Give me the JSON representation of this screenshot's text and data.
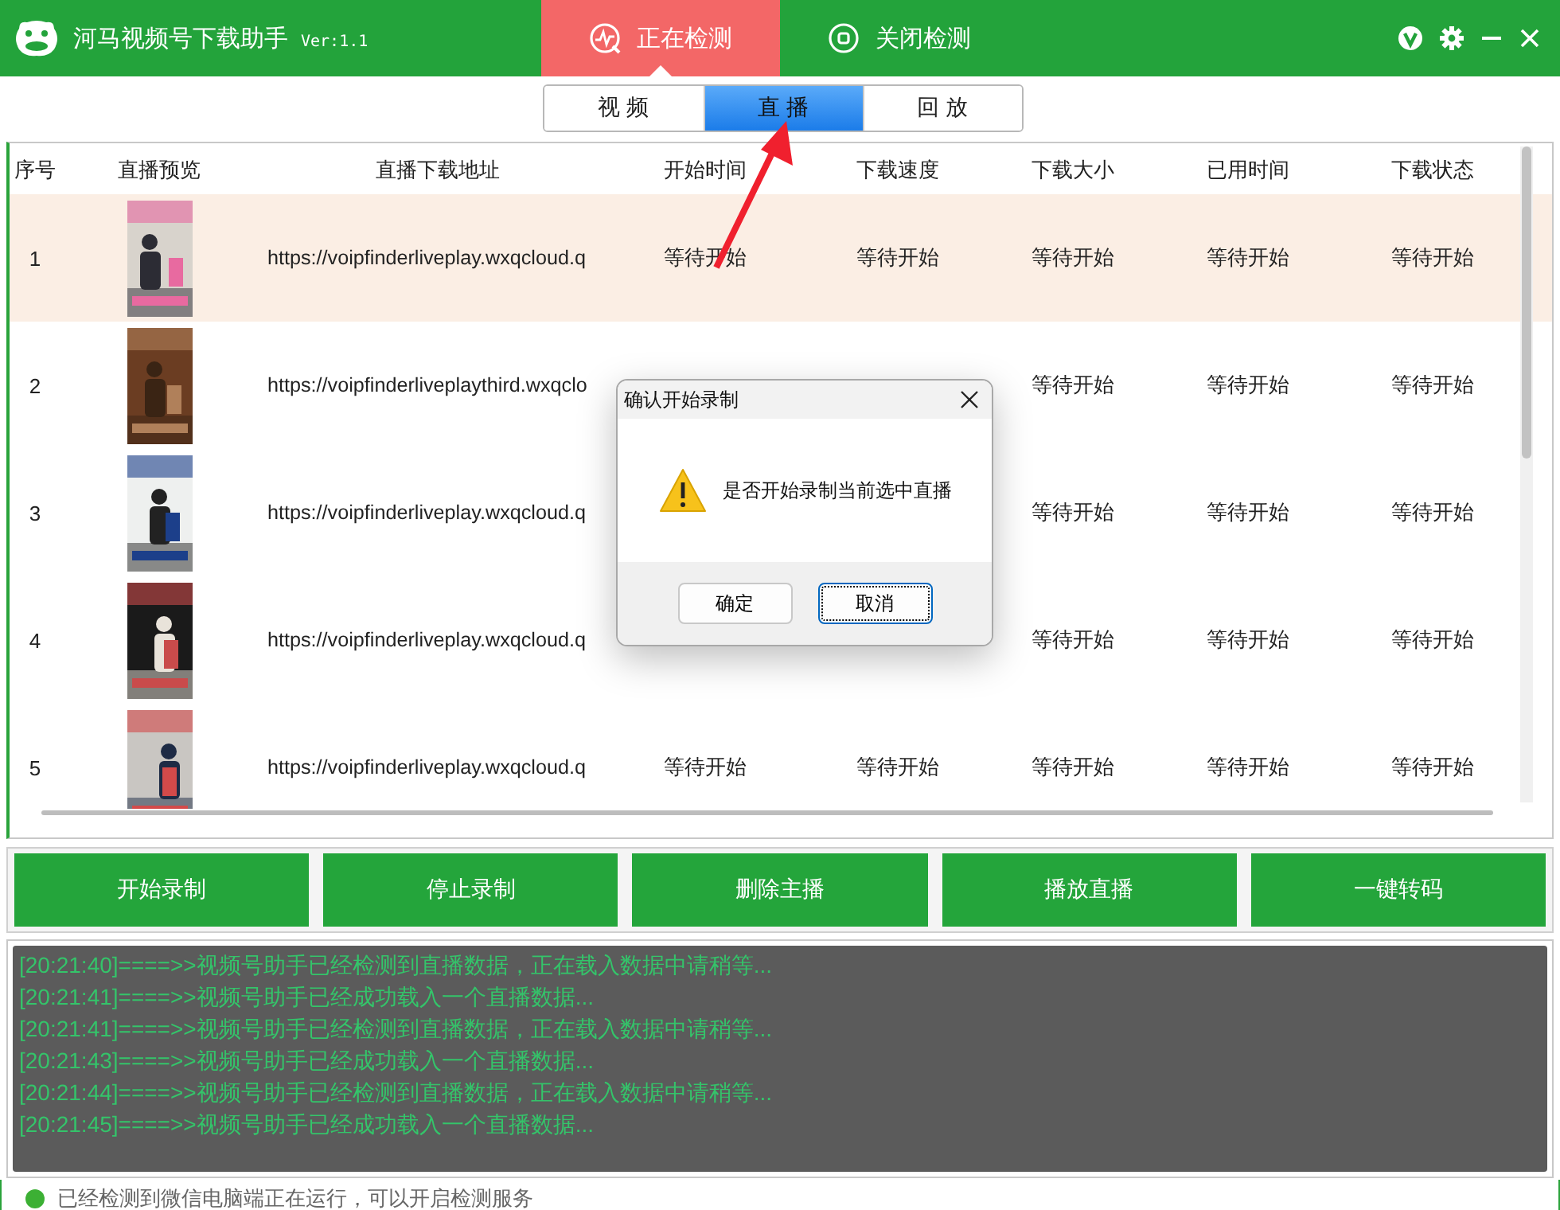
{
  "app": {
    "title": "河马视频号下载助手",
    "version": "Ver:1.1"
  },
  "top_tabs": [
    {
      "label": "正在检测",
      "selected": true,
      "kind": "radar"
    },
    {
      "label": "关闭检测",
      "selected": false,
      "kind": "stop"
    }
  ],
  "mode_tabs": [
    {
      "label": "视 频",
      "selected": false
    },
    {
      "label": "直 播",
      "selected": true
    },
    {
      "label": "回 放",
      "selected": false
    }
  ],
  "table": {
    "columns": [
      "序号",
      "直播预览",
      "直播下载地址",
      "开始时间",
      "下载速度",
      "下载大小",
      "已用时间",
      "下载状态"
    ],
    "rows": [
      {
        "index": "1",
        "url": "https://voipfinderliveplay.wxqcloud.q",
        "start_time": "等待开始",
        "speed": "等待开始",
        "size": "等待开始",
        "elapsed": "等待开始",
        "status": "等待开始",
        "selected": true
      },
      {
        "index": "2",
        "url": "https://voipfinderliveplaythird.wxqclo",
        "size": "等待开始",
        "elapsed": "等待开始",
        "status": "等待开始",
        "selected": false
      },
      {
        "index": "3",
        "url": "https://voipfinderliveplay.wxqcloud.q",
        "size": "等待开始",
        "elapsed": "等待开始",
        "status": "等待开始",
        "selected": false
      },
      {
        "index": "4",
        "url": "https://voipfinderliveplay.wxqcloud.q",
        "size": "等待开始",
        "elapsed": "等待开始",
        "status": "等待开始",
        "selected": false
      },
      {
        "index": "5",
        "url": "https://voipfinderliveplay.wxqcloud.q",
        "start_time": "等待开始",
        "speed": "等待开始",
        "size": "等待开始",
        "elapsed": "等待开始",
        "status": "等待开始",
        "selected": false
      }
    ]
  },
  "buttons": [
    "开始录制",
    "停止录制",
    "删除主播",
    "播放直播",
    "一键转码"
  ],
  "log": [
    "[20:21:40]====>>视频号助手已经检测到直播数据，正在载入数据中请稍等...",
    "[20:21:41]====>>视频号助手已经成功载入一个直播数据...",
    "[20:21:41]====>>视频号助手已经检测到直播数据，正在载入数据中请稍等...",
    "[20:21:43]====>>视频号助手已经成功载入一个直播数据...",
    "[20:21:44]====>>视频号助手已经检测到直播数据，正在载入数据中请稍等...",
    "[20:21:45]====>>视频号助手已经成功载入一个直播数据..."
  ],
  "status_bar": {
    "text": "已经检测到微信电脑端正在运行，可以开启检测服务"
  },
  "dialog": {
    "title": "确认开始录制",
    "message": "是否开始录制当前选中直播",
    "buttons": [
      {
        "label": "确定",
        "focused": false
      },
      {
        "label": "取消",
        "focused": true
      }
    ]
  }
}
